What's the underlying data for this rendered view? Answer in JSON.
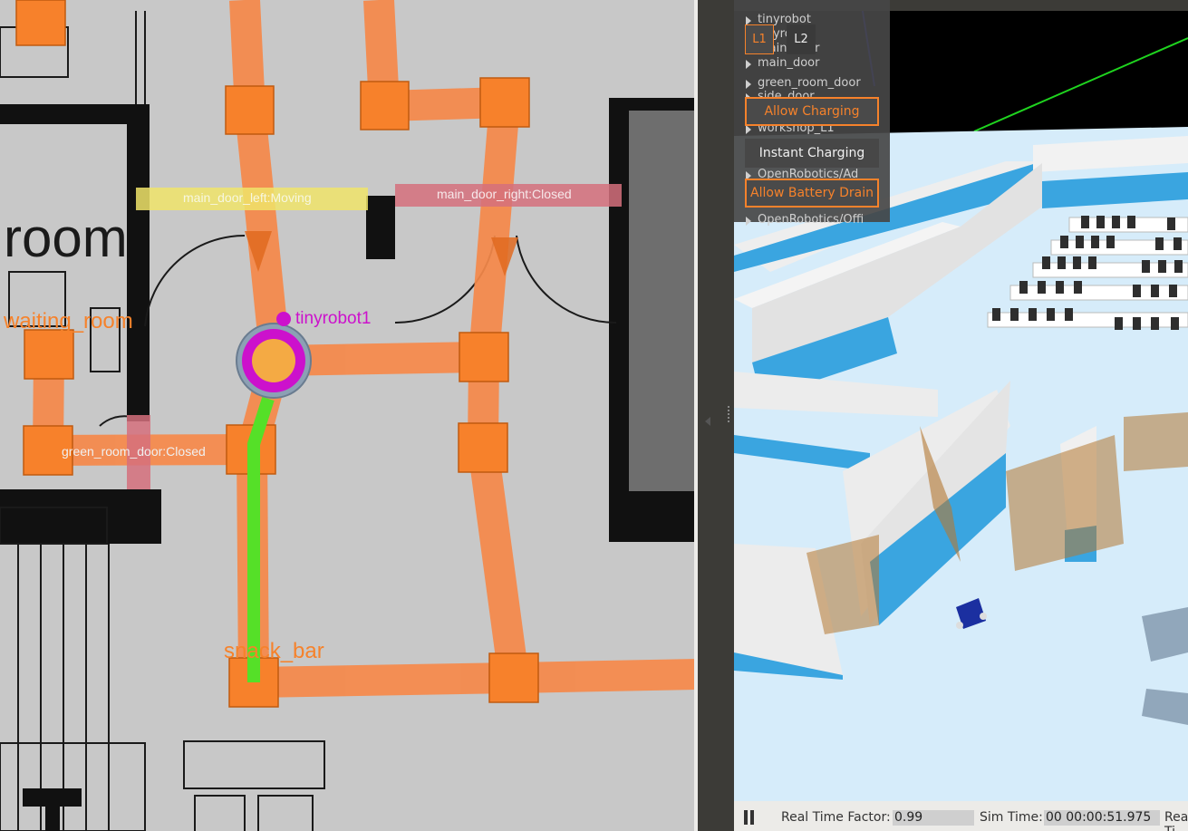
{
  "map": {
    "room_labels": {
      "room_partial": "room",
      "waiting_room": "waiting_room",
      "snack_bar": "snack_bar"
    },
    "doors": {
      "main_door_left": "main_door_left:Moving",
      "main_door_right": "main_door_right:Closed",
      "green_room_door": "green_room_door:Closed"
    },
    "robot_name": "tinyrobot1",
    "colors": {
      "lane": "#f6894a",
      "waypoint": "#f7812b",
      "path": "#55e028",
      "robot": "#cc11cc",
      "door_moving": "#f0e46a",
      "door_closed": "#d5707c"
    }
  },
  "sim": {
    "tree_items": [
      "tinyrobot",
      "tinyrobot",
      "main_door",
      "main_door",
      "green_room_door",
      "side_door",
      "workshop_L1",
      "OpenRobotics/Ad",
      "OpenRobotics/Offi"
    ],
    "levels": [
      "L1",
      "L2"
    ],
    "active_level": "L1",
    "buttons": {
      "allow_charging": "Allow Charging",
      "instant_charging": "Instant Charging",
      "allow_battery_drain": "Allow Battery Drain"
    },
    "status": {
      "rtf_label": "Real Time Factor:",
      "rtf_value": "0.99",
      "sim_time_label": "Sim Time:",
      "sim_time_value": "00 00:00:51.975",
      "real_time_label": "Real Ti"
    }
  }
}
